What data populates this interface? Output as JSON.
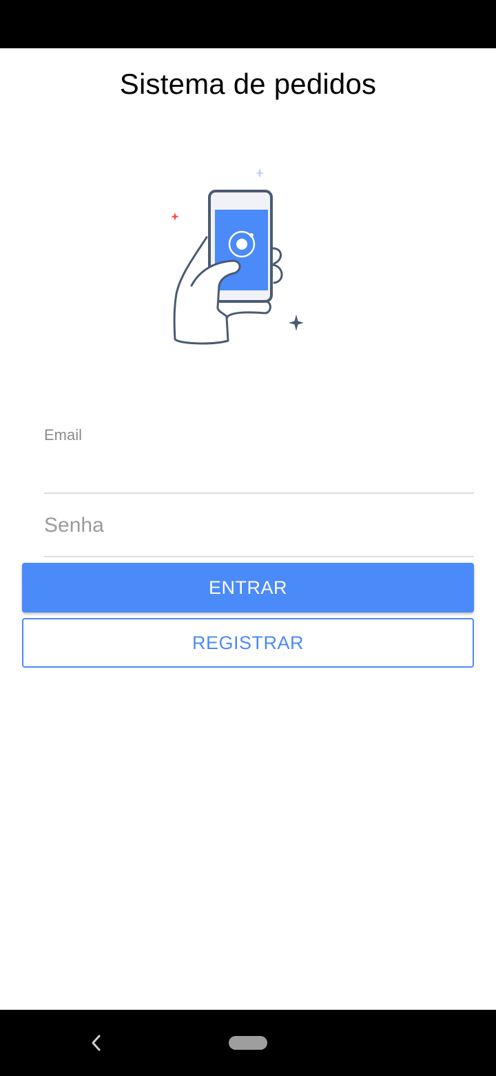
{
  "header": {
    "title": "Sistema de pedidos"
  },
  "illustration": {
    "icon": "phone-in-hand-icon",
    "colors": {
      "outline": "#4b5a72",
      "screen": "#4a8af9",
      "sparkle_red": "#ff4c4c",
      "sparkle_blue": "#b9d6fa",
      "sparkle_dark": "#4b5a72"
    }
  },
  "form": {
    "email": {
      "label": "Email",
      "value": ""
    },
    "password": {
      "placeholder": "Senha",
      "value": ""
    },
    "login_label": "ENTRAR",
    "register_label": "REGISTRAR"
  },
  "colors": {
    "accent": "#4a8af9",
    "system_bars": "#000000"
  }
}
